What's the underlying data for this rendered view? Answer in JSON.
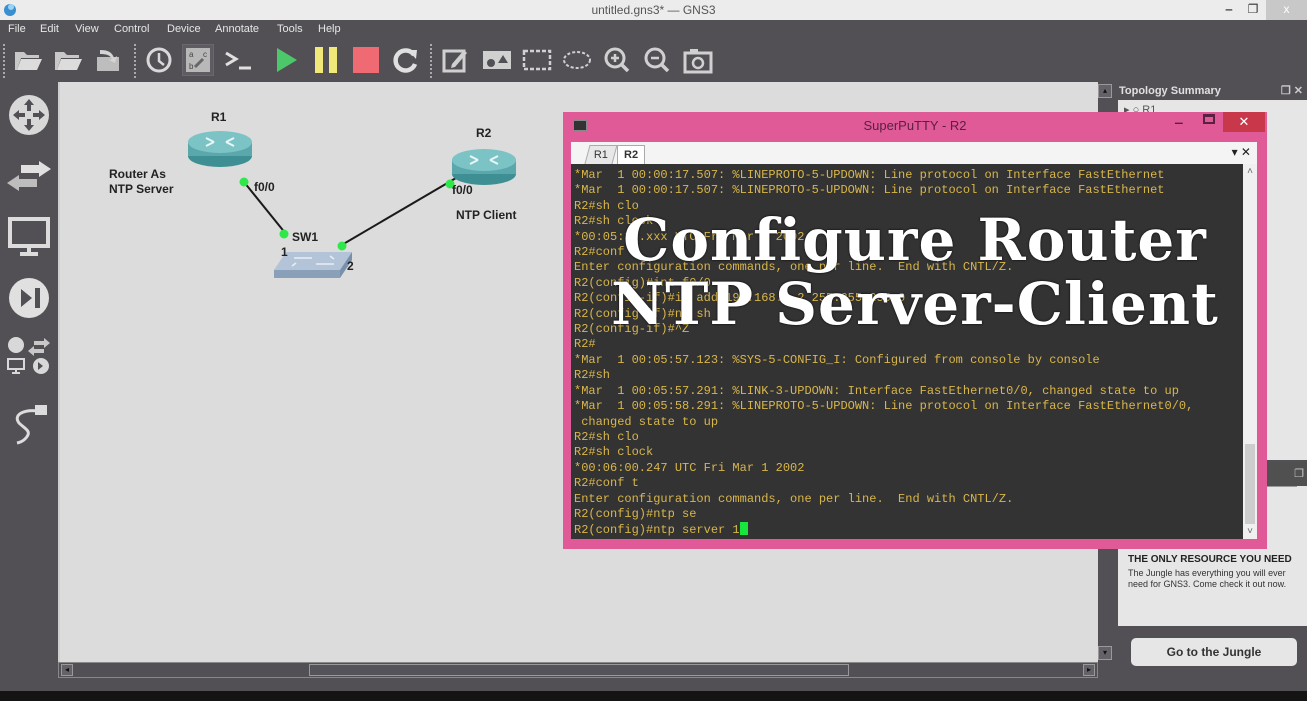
{
  "window": {
    "title": "untitled.gns3* — GNS3",
    "minimize": "‒",
    "maximize": "❐",
    "close": "x"
  },
  "menu": {
    "items": [
      "File",
      "Edit",
      "View",
      "Control",
      "Device",
      "Annotate",
      "Tools",
      "Help"
    ]
  },
  "toolbar": {
    "icons": [
      "open-folder-icon",
      "open-folder-icon",
      "save-icon",
      "clock-icon",
      "abc-label-icon",
      "console-icon",
      "start-icon",
      "pause-icon",
      "stop-icon",
      "reload-icon",
      "edit-note-icon",
      "insert-image-icon",
      "rectangle-icon",
      "ellipse-icon",
      "zoom-in-icon",
      "zoom-out-icon",
      "screenshot-icon"
    ],
    "colors": {
      "start": "#4cc86a",
      "pause": "#f0e878",
      "stop": "#f06a74"
    }
  },
  "dock": {
    "icons": [
      "router-icon",
      "switch-icon",
      "end-device-icon",
      "security-device-icon",
      "all-devices-icon",
      "add-link-icon"
    ]
  },
  "topology": {
    "nodes": [
      {
        "id": "R1",
        "label": "R1"
      },
      {
        "id": "R2",
        "label": "R2"
      },
      {
        "id": "SW1",
        "label": "SW1"
      }
    ],
    "ports": {
      "r1": "f0/0",
      "r2": "f0/0",
      "sw1_a": "1",
      "sw1_b": "2"
    },
    "notes": {
      "server": [
        "Router As",
        "NTP Server"
      ],
      "client": "NTP Client"
    },
    "link_color": "#1a1a1a",
    "port_color": "#2ee84a"
  },
  "right_panel": {
    "topology_summary": "Topology Summary",
    "first_node": "R1",
    "ad_title": "THE ONLY RESOURCE YOU NEED",
    "ad_text": "The Jungle has everything you will ever need for GNS3. Come check it out now.",
    "jungle_button": "Go to the Jungle"
  },
  "putty": {
    "title": "SuperPuTTY - R2",
    "tabs": [
      "R1",
      "R2"
    ],
    "active_tab": "R2",
    "tab_controls": "▾ ✕",
    "border_color": "#e05a98",
    "terminal_lines": [
      "*Mar  1 00:00:17.507: %LINEPROTO-5-UPDOWN: Line protocol on Interface FastEthernet",
      "*Mar  1 00:00:17.507: %LINEPROTO-5-UPDOWN: Line protocol on Interface FastEthernet",
      "R2#sh clo",
      "R2#sh clock",
      "*00:05:37.xxx UTC Fri Mar 1 2002",
      "R2#conf t",
      "Enter configuration commands, one per line.  End with CNTL/Z.",
      "R2(config)#int f0/0",
      "R2(config-if)#ip add 192.168.1.2 255.255.255.0",
      "R2(config-if)#no sh",
      "R2(config-if)#^Z",
      "R2#",
      "*Mar  1 00:05:57.123: %SYS-5-CONFIG_I: Configured from console by console",
      "R2#sh",
      "*Mar  1 00:05:57.291: %LINK-3-UPDOWN: Interface FastEthernet0/0, changed state to up",
      "*Mar  1 00:05:58.291: %LINEPROTO-5-UPDOWN: Line protocol on Interface FastEthernet0/0,",
      " changed state to up",
      "R2#sh clo",
      "R2#sh clock",
      "*00:06:00.247 UTC Fri Mar 1 2002",
      "R2#conf t",
      "Enter configuration commands, one per line.  End with CNTL/Z.",
      "R2(config)#ntp se",
      "R2(config)#ntp server 1"
    ]
  },
  "overlay": {
    "line1": "Configure Router",
    "line2": "NTP Server-Client"
  }
}
